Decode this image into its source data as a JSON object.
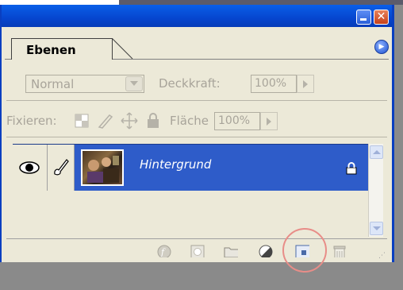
{
  "panel": {
    "tab_label": "Ebenen",
    "blend_mode": "Normal",
    "opacity_label": "Deckkraft:",
    "opacity_value": "100%",
    "lock_label": "Fixieren:",
    "fill_label": "Fläche",
    "fill_value": "100%"
  },
  "layers": [
    {
      "name": "Hintergrund",
      "selected": true,
      "visible": true,
      "locked": true
    }
  ],
  "bottom_icons": [
    "layer-style-icon",
    "layer-mask-icon",
    "new-group-icon",
    "adjustment-layer-icon",
    "new-layer-icon",
    "trash-icon"
  ],
  "colors": {
    "titlebar": "#0646cf",
    "selection": "#2e5cc9",
    "panel_bg": "#ece9d8",
    "highlight_circle": "#e88d88"
  }
}
